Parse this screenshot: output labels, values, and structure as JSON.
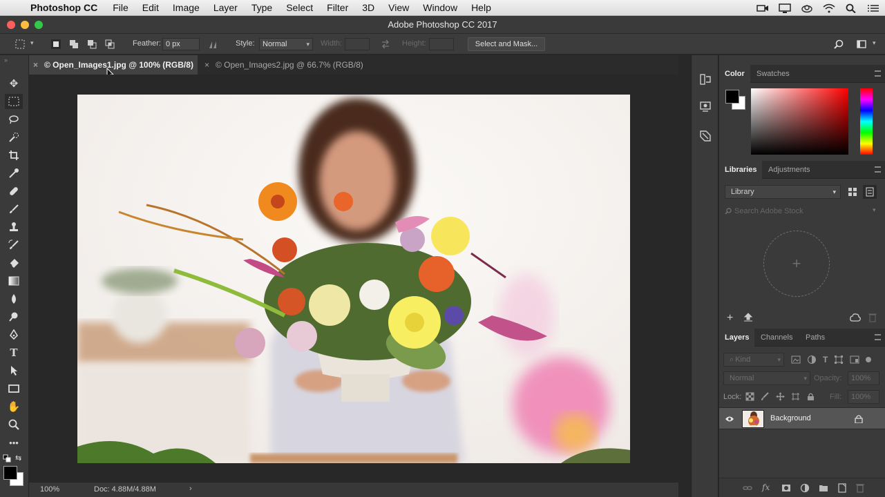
{
  "menubar": {
    "app_name": "Photoshop CC",
    "items": [
      "File",
      "Edit",
      "Image",
      "Layer",
      "Type",
      "Select",
      "Filter",
      "3D",
      "View",
      "Window",
      "Help"
    ]
  },
  "window": {
    "title": "Adobe Photoshop CC 2017"
  },
  "options": {
    "feather_label": "Feather:",
    "feather_value": "0 px",
    "style_label": "Style:",
    "style_value": "Normal",
    "width_label": "Width:",
    "height_label": "Height:",
    "select_mask_label": "Select and Mask..."
  },
  "doc_tabs": [
    {
      "label": "© Open_Images1.jpg @ 100% (RGB/8)",
      "active": true
    },
    {
      "label": "© Open_Images2.jpg @ 66.7% (RGB/8)",
      "active": false
    }
  ],
  "status": {
    "zoom": "100%",
    "doc_size": "Doc: 4.88M/4.88M"
  },
  "color_panel": {
    "tabs": [
      "Color",
      "Swatches"
    ],
    "foreground": "#000000",
    "background": "#ffffff",
    "hue_color": "#ff0000"
  },
  "libraries_panel": {
    "tabs": [
      "Libraries",
      "Adjustments"
    ],
    "library_select": "Library",
    "search_placeholder": "Search Adobe Stock"
  },
  "layers_panel": {
    "tabs": [
      "Layers",
      "Channels",
      "Paths"
    ],
    "filter_kind": "Kind",
    "blend_mode": "Normal",
    "opacity_label": "Opacity:",
    "opacity_value": "100%",
    "lock_label": "Lock:",
    "fill_label": "Fill:",
    "fill_value": "100%",
    "layers": [
      {
        "name": "Background",
        "visible": true,
        "locked": true
      }
    ]
  }
}
